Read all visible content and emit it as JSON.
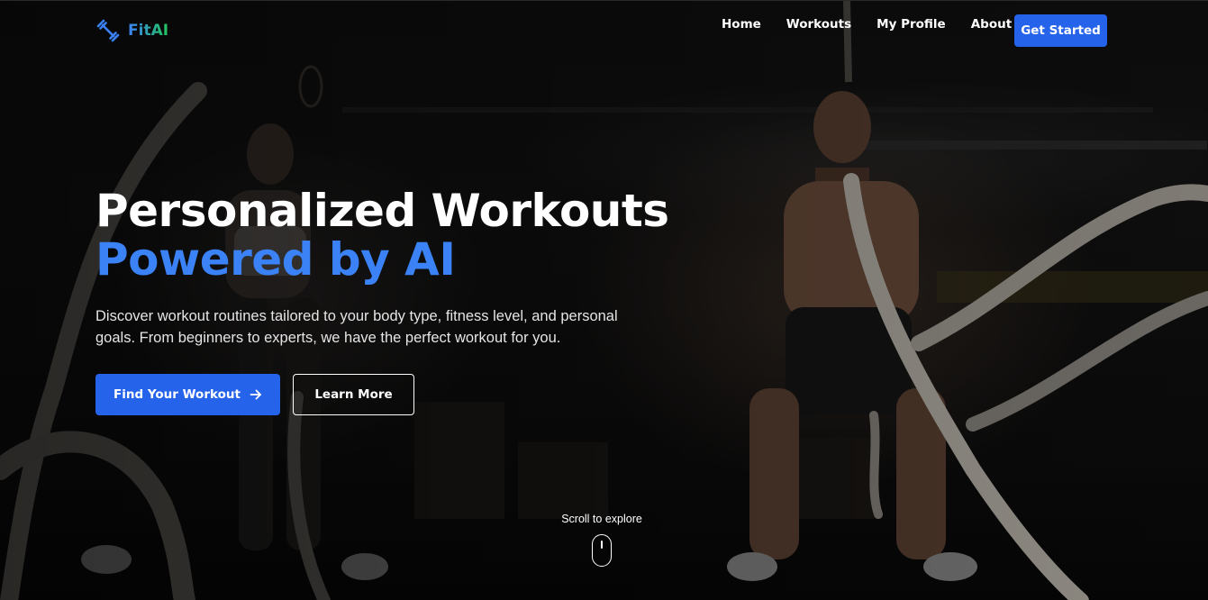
{
  "brand": {
    "name": "FitAI",
    "icon": "dumbbell-icon",
    "gradient_from": "#3b82f6",
    "gradient_to": "#22c55e"
  },
  "nav": {
    "links": [
      {
        "label": "Home"
      },
      {
        "label": "Workouts"
      },
      {
        "label": "My Profile"
      },
      {
        "label": "About"
      }
    ],
    "cta_label": "Get Started"
  },
  "hero": {
    "headline_line1": "Personalized Workouts",
    "headline_line2": "Powered by AI",
    "subtext": "Discover workout routines tailored to your body type, fitness level, and personal goals. From beginners to experts, we have the perfect workout for you.",
    "primary_button": {
      "label": "Find Your Workout",
      "icon": "arrow-right-icon"
    },
    "secondary_button": {
      "label": "Learn More"
    },
    "background": "gym-battle-ropes-photo"
  },
  "scroll_hint": {
    "label": "Scroll to explore",
    "icon": "mouse-icon"
  },
  "colors": {
    "accent": "#2563eb",
    "headline_accent": "#3b82f6",
    "text": "#ffffff"
  }
}
